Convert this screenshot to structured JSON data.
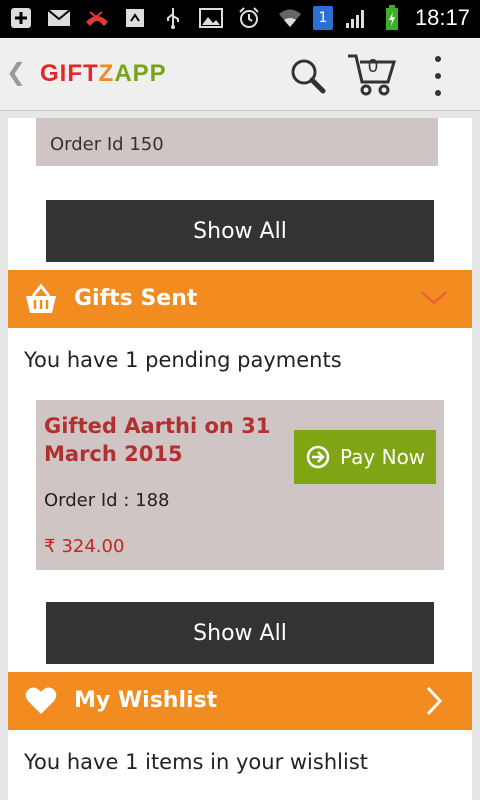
{
  "statusbar": {
    "time": "18:17",
    "notification_badge": "1"
  },
  "appbar": {
    "back_glyph": "❮",
    "logo": {
      "part1": "GIFT",
      "part2": "Z",
      "part3": "APP"
    },
    "cart_count": "0"
  },
  "orders_section": {
    "order_label": "Order Id 150",
    "show_all_label": "Show All"
  },
  "gifts_sent": {
    "title": "Gifts Sent",
    "pending_text": "You have 1 pending payments",
    "card": {
      "title": "Gifted Aarthi on 31 March 2015",
      "order_id": "Order Id : 188",
      "currency_symbol": "₹",
      "amount": "324.00",
      "pay_label": "Pay Now"
    },
    "show_all_label": "Show All"
  },
  "wishlist": {
    "title": "My Wishlist",
    "status_text": "You have 1 items in your wishlist"
  },
  "colors": {
    "accent_orange": "#f28b20",
    "pay_green": "#7fa515",
    "card_bg": "#cfc5c5",
    "title_red": "#b43030"
  },
  "icons": [
    "add-box-icon",
    "mail-icon",
    "missed-call-icon",
    "sync-icon",
    "usb-icon",
    "image-icon",
    "alarm-icon",
    "wifi-icon",
    "signal-icon",
    "battery-icon",
    "search-icon",
    "cart-icon",
    "overflow-menu-icon",
    "basket-icon",
    "chevron-down-icon",
    "heart-icon",
    "chevron-right-icon",
    "arrow-circle-icon"
  ]
}
